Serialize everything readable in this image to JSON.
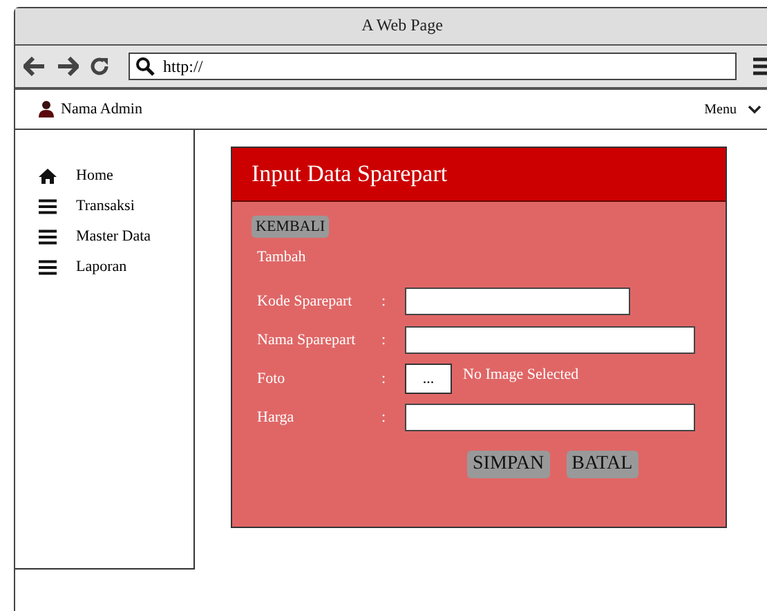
{
  "window": {
    "title": "A Web Page"
  },
  "address_bar": {
    "value": "http://"
  },
  "navbar": {
    "user": "Nama Admin",
    "menu": "Menu"
  },
  "sidebar": {
    "items": [
      {
        "label": "Home",
        "kind": "home"
      },
      {
        "label": "Transaksi",
        "kind": "list"
      },
      {
        "label": "Master Data",
        "kind": "list"
      },
      {
        "label": "Laporan",
        "kind": "list"
      }
    ]
  },
  "panel": {
    "title": "Input Data Sparepart",
    "back_button": "KEMBALI",
    "subtitle": "Tambah",
    "fields": [
      {
        "label": "Kode Sparepart",
        "colon": ":",
        "kind": "short"
      },
      {
        "label": "Nama Sparepart",
        "colon": ":",
        "kind": "long"
      },
      {
        "label": "Foto",
        "colon": ":",
        "kind": "file",
        "button": "...",
        "note": "No Image Selected"
      },
      {
        "label": "Harga",
        "colon": ":",
        "kind": "long"
      }
    ],
    "buttons": [
      "SIMPAN",
      "BATAL"
    ]
  }
}
